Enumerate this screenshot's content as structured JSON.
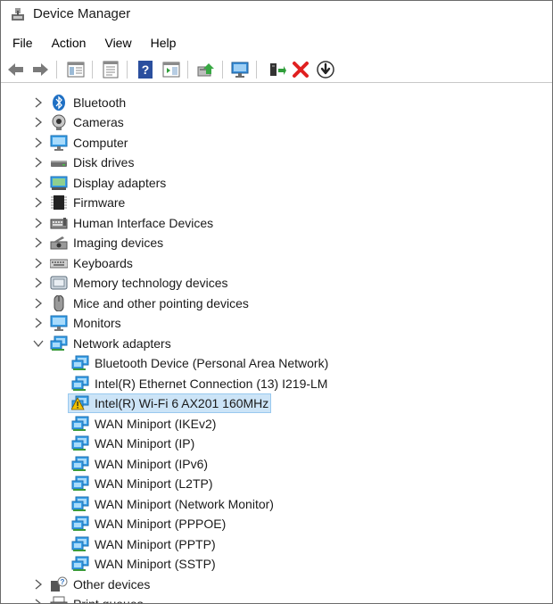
{
  "window": {
    "title": "Device Manager"
  },
  "menu": [
    "File",
    "Action",
    "View",
    "Help"
  ],
  "toolbar_icons": [
    "back-arrow-icon",
    "forward-arrow-icon",
    "show-hide-console-tree-icon",
    "properties-icon",
    "help-icon",
    "action-pane-icon",
    "update-driver-icon",
    "scan-hardware-icon",
    "add-legacy-hardware-icon",
    "uninstall-device-icon",
    "disable-device-icon"
  ],
  "tree": {
    "categories": [
      {
        "label": "Bluetooth",
        "icon": "bluetooth-icon"
      },
      {
        "label": "Cameras",
        "icon": "camera-icon"
      },
      {
        "label": "Computer",
        "icon": "computer-icon"
      },
      {
        "label": "Disk drives",
        "icon": "disk-drive-icon"
      },
      {
        "label": "Display adapters",
        "icon": "display-adapter-icon"
      },
      {
        "label": "Firmware",
        "icon": "firmware-icon"
      },
      {
        "label": "Human Interface Devices",
        "icon": "hid-icon"
      },
      {
        "label": "Imaging devices",
        "icon": "imaging-device-icon"
      },
      {
        "label": "Keyboards",
        "icon": "keyboard-icon"
      },
      {
        "label": "Memory technology devices",
        "icon": "memory-device-icon"
      },
      {
        "label": "Mice and other pointing devices",
        "icon": "mouse-icon"
      },
      {
        "label": "Monitors",
        "icon": "monitor-icon"
      },
      {
        "label": "Network adapters",
        "icon": "network-adapter-icon",
        "expanded": true
      },
      {
        "label": "Other devices",
        "icon": "other-devices-icon"
      },
      {
        "label": "Print queues",
        "icon": "printer-icon"
      }
    ],
    "network_children": [
      {
        "label": "Bluetooth Device (Personal Area Network)"
      },
      {
        "label": "Intel(R) Ethernet Connection (13) I219-LM"
      },
      {
        "label": "Intel(R) Wi-Fi 6 AX201 160MHz",
        "selected": true,
        "warning": true
      },
      {
        "label": "WAN Miniport (IKEv2)"
      },
      {
        "label": "WAN Miniport (IP)"
      },
      {
        "label": "WAN Miniport (IPv6)"
      },
      {
        "label": "WAN Miniport (L2TP)"
      },
      {
        "label": "WAN Miniport (Network Monitor)"
      },
      {
        "label": "WAN Miniport (PPPOE)"
      },
      {
        "label": "WAN Miniport (PPTP)"
      },
      {
        "label": "WAN Miniport (SSTP)"
      }
    ]
  },
  "colors": {
    "selection": "#cce4f7",
    "selection_border": "#99c9ef",
    "warning": "#f2c200",
    "error_x": "#e02020"
  }
}
